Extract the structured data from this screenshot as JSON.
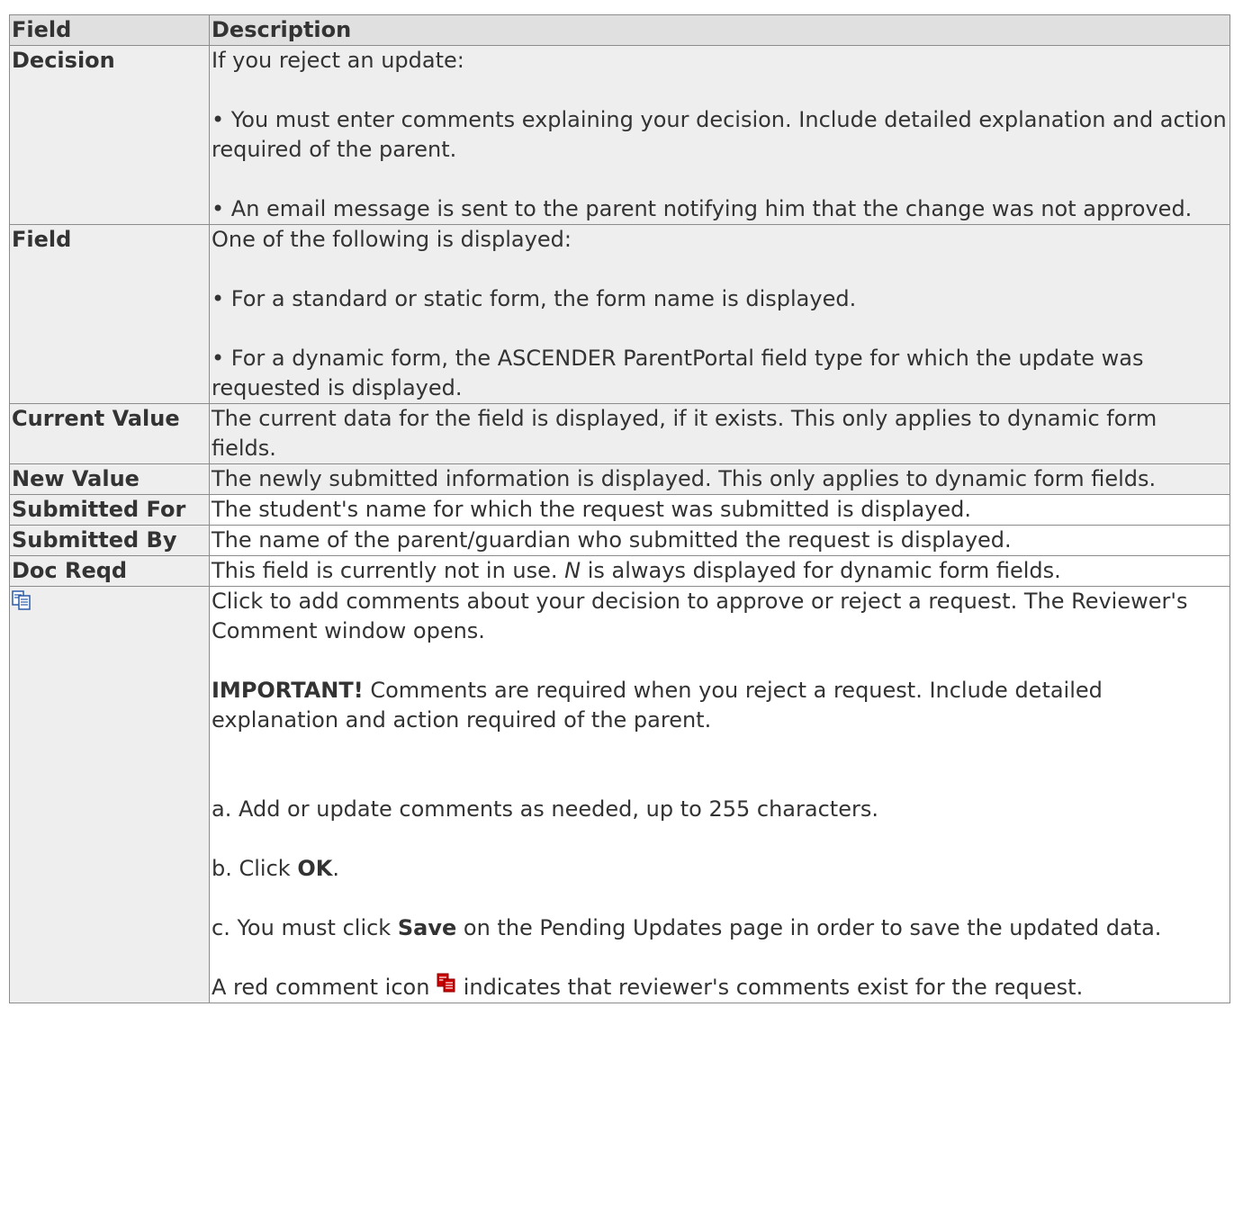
{
  "header": {
    "field": "Field",
    "description": "Description"
  },
  "rows": [
    {
      "field": "Decision",
      "paras": [
        "If you reject an update:",
        "• You must enter comments explaining your decision. Include detailed explanation and action required of the parent.",
        "• An email message is sent to the parent notifying him that the change was not approved."
      ]
    },
    {
      "field": "Field",
      "paras": [
        "One of the following is displayed:",
        "• For a standard or static form, the form name is displayed.",
        "• For a dynamic form, the ASCENDER ParentPortal field type for which the update was requested is displayed."
      ]
    },
    {
      "field": "Current Value",
      "paras": [
        "The current data for the field is displayed, if it exists. This only applies to dynamic form fields."
      ]
    },
    {
      "field": "New Value",
      "paras": [
        "The newly submitted information is displayed. This only applies to dynamic form fields."
      ]
    },
    {
      "field": "Submitted For",
      "paras": [
        "The student's name for which the request was submitted is displayed."
      ]
    },
    {
      "field": "Submitted By",
      "paras": [
        "The name of the parent/guardian who submitted the request is displayed."
      ]
    },
    {
      "field": "Doc Reqd",
      "pre": "This field is currently not in use. ",
      "em": "N",
      "post": " is always displayed for dynamic form fields."
    }
  ],
  "comment_row": {
    "icon": "comment-icon",
    "intro": "Click to add comments about your decision to approve or reject a request. The Reviewer's Comment window opens.",
    "important_label": "IMPORTANT!",
    "important_text": " Comments are required when you reject a request. Include detailed explanation and action required of the parent.",
    "step_a": "a. Add or update comments as needed, up to 255 characters.",
    "step_b_pre": "b. Click ",
    "step_b_bold": "OK",
    "step_b_post": ".",
    "step_c_pre": "c. You must click ",
    "step_c_bold": "Save",
    "step_c_post": " on the Pending Updates page in order to save the updated data.",
    "red_pre": "A red comment icon ",
    "red_icon": "red-comment-icon",
    "red_post": " indicates that reviewer's comments exist for the request."
  },
  "colors": {
    "header_bg": "#e0e0e0",
    "shaded_row_bg": "#eeeeee",
    "border": "#8c8c8c",
    "text": "#333333",
    "red_icon": "#cc0000",
    "icon_blue": "#2a5aa8"
  }
}
